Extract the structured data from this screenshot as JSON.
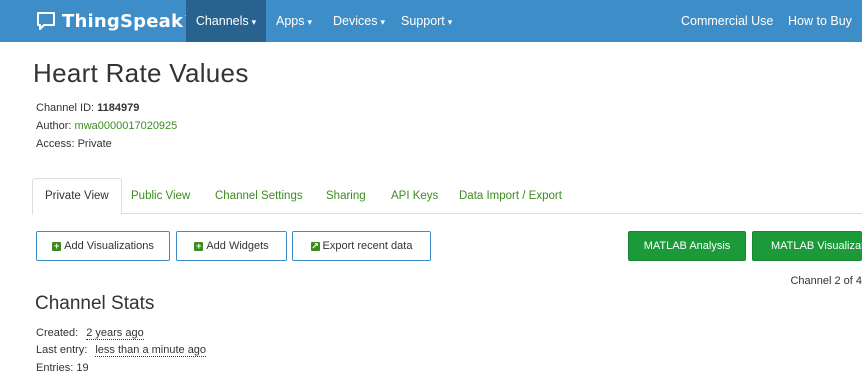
{
  "navbar": {
    "brand": "ThingSpeak",
    "brand_tm": "™",
    "items": [
      {
        "label": "Channels",
        "caret": "▾"
      },
      {
        "label": "Apps",
        "caret": "▾"
      },
      {
        "label": "Devices",
        "caret": "▾"
      },
      {
        "label": "Support",
        "caret": "▾"
      }
    ],
    "right_items": [
      "Commercial Use",
      "How to Buy"
    ],
    "bg_color": "#3d8ec8",
    "active_color": "#28628f"
  },
  "channel": {
    "title": "Heart Rate Values",
    "id_label": "Channel ID: ",
    "id_value": "1184979",
    "author_label": "Author: ",
    "author_value": "mwa0000017020925",
    "access": "Access: Private"
  },
  "tabs": [
    {
      "label": "Private View",
      "active": true
    },
    {
      "label": "Public View"
    },
    {
      "label": "Channel Settings"
    },
    {
      "label": "Sharing"
    },
    {
      "label": "API Keys"
    },
    {
      "label": "Data Import / Export"
    }
  ],
  "buttons": {
    "add_visualizations": "Add Visualizations",
    "add_widgets": "Add Widgets",
    "export_recent": "Export recent data",
    "matlab_analysis": "MATLAB Analysis",
    "matlab_visualization": "MATLAB Visualizat"
  },
  "channel_position": "Channel 2 of 4",
  "stats": {
    "title": "Channel Stats",
    "created_label": "Created:",
    "created_value": "2 years ago",
    "last_entry_label": "Last entry:",
    "last_entry_value": "less than a minute ago",
    "entries": "Entries: 19"
  },
  "colors": {
    "link_green": "#3c8d1f",
    "button_green": "#1c9a3a",
    "button_border_blue": "#3d8ec8"
  }
}
